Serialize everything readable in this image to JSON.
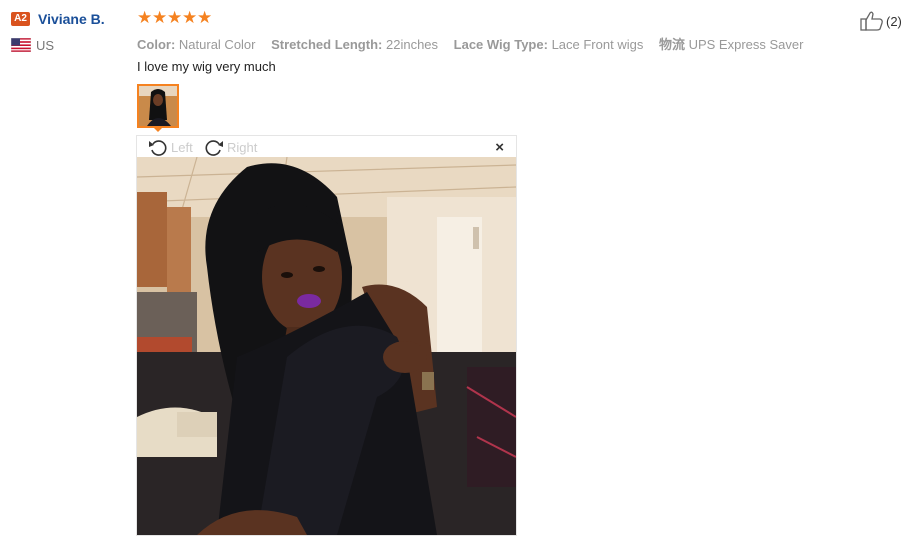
{
  "reviewer": {
    "level_badge": "A2",
    "name": "Viviane B.",
    "country": "US"
  },
  "rating": {
    "stars": 5,
    "max": 5
  },
  "attributes": [
    {
      "key": "Color:",
      "value": "Natural Color"
    },
    {
      "key": "Stretched Length:",
      "value": "22inches"
    },
    {
      "key": "Lace Wig Type:",
      "value": "Lace Front wigs"
    },
    {
      "key": "物流",
      "value": "UPS Express Saver"
    }
  ],
  "review_text": "I love my wig very much",
  "viewer": {
    "rotate_left_label": "Left",
    "rotate_right_label": "Right",
    "close_label": "×"
  },
  "helpful": {
    "count_label": "(2)"
  },
  "colors": {
    "accent": "#f58220",
    "link": "#1a4f99",
    "badge": "#d9531e"
  }
}
